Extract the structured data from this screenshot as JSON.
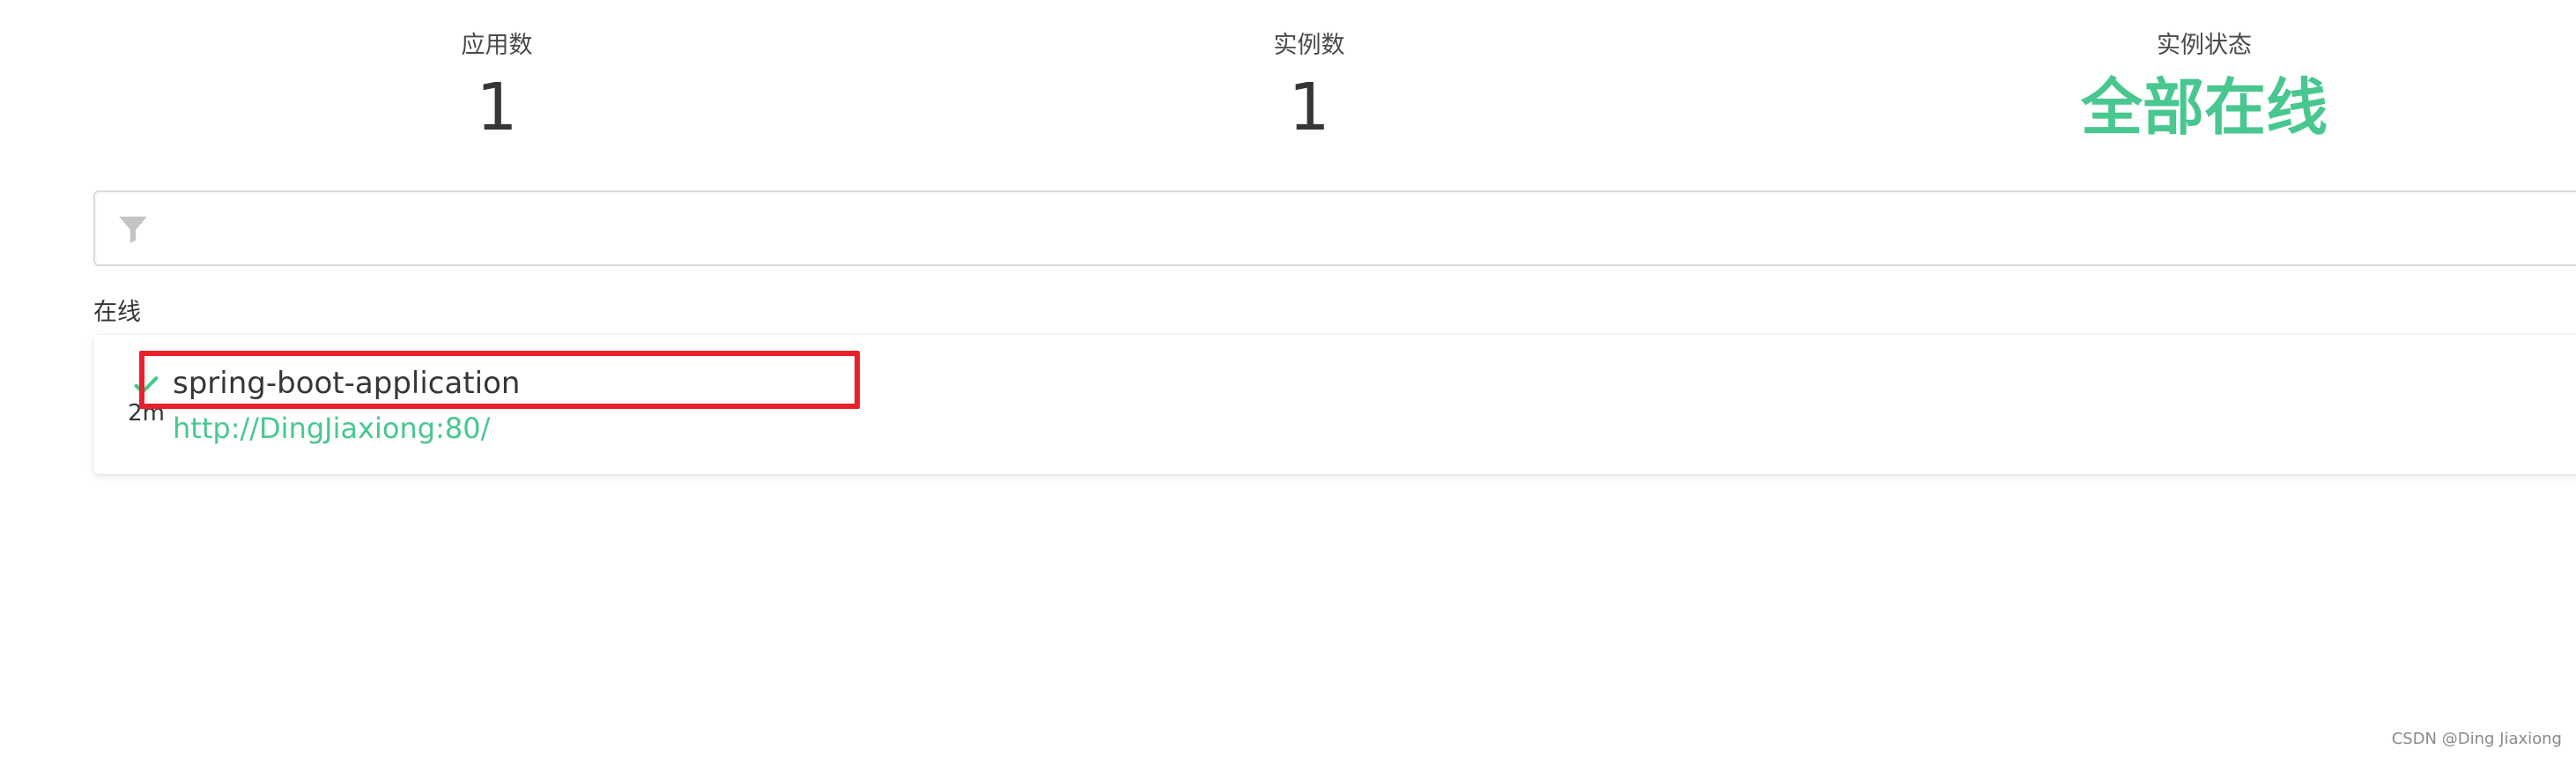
{
  "stats": {
    "apps_label": "应用数",
    "apps_value": "1",
    "instances_label": "实例数",
    "instances_value": "1",
    "status_label": "实例状态",
    "status_value": "全部在线"
  },
  "filter": {
    "placeholder": "",
    "icon": "filter-icon"
  },
  "section": {
    "title": "在线"
  },
  "applications": [
    {
      "name": "spring-boot-application",
      "url": "http://DingJiaxiong:80/",
      "uptime": "2m",
      "status_icon": "check-icon"
    }
  ],
  "colors": {
    "success": "#48c78e",
    "highlight": "#e8202a",
    "text": "#363636"
  },
  "watermark": "CSDN @Ding Jiaxiong"
}
